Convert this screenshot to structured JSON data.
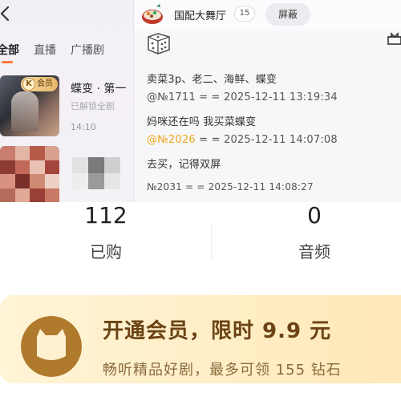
{
  "tabs": [
    {
      "label": "全部"
    },
    {
      "label": "直播"
    },
    {
      "label": "广播剧"
    }
  ],
  "drama": {
    "badge_letter": "K",
    "badge_label": "会员",
    "title": "蝶变 · 第一",
    "subtitle": "已解锁全剧",
    "time": "14:10"
  },
  "popup": {
    "room_name": "国配大舞厅",
    "room_count": "15",
    "block_label": "屏蔽",
    "messages": [
      {
        "text": "卖菜3p、老二、海鲜、蝶变"
      },
      {
        "text": "@№1711 = = 2025-12-11 13:19:34"
      },
      {
        "text": "妈咪还在吗 我买菜蝶变"
      },
      {
        "mention": "@№2026",
        "text": " = = 2025-12-11 14:07:08"
      },
      {
        "text": "去买，记得双屏"
      },
      {
        "text": "№2031 = = 2025-12-11 14:08:27"
      }
    ]
  },
  "stats": [
    {
      "value": "112",
      "label": "已购"
    },
    {
      "value": "0",
      "label": "音频"
    }
  ],
  "vip_banner": {
    "title": "开通会员，限时 9.9 元",
    "subtitle": "畅听精品好剧，最多可领 155 钻石"
  },
  "colors": {
    "accent_orange": "#ff7a3d",
    "mention_gold": "#f0a51e",
    "banner_bg": "#ffe8b8",
    "banner_text": "#6b4314"
  }
}
